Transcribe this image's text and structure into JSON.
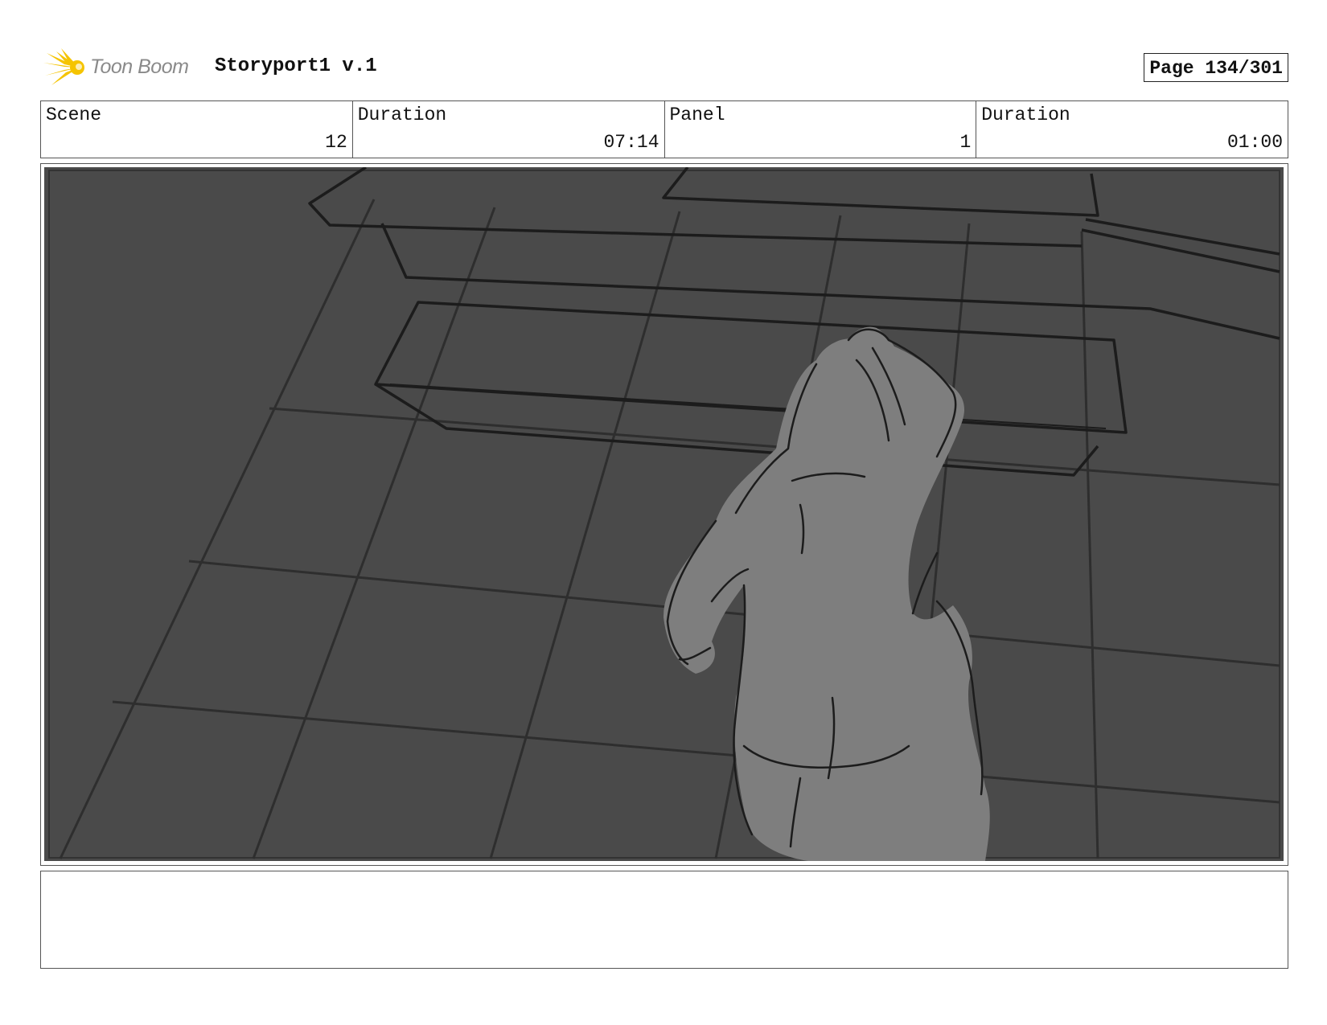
{
  "header": {
    "logo_text": "Toon Boom",
    "logo_icon": "starburst-logo-icon",
    "project_title": "Storyport1 v.1",
    "page_label": "Page 134/301"
  },
  "info": {
    "scene_label": "Scene",
    "scene_value": "12",
    "scene_duration_label": "Duration",
    "scene_duration_value": "07:14",
    "panel_label": "Panel",
    "panel_value": "1",
    "panel_duration_label": "Duration",
    "panel_duration_value": "01:00"
  },
  "panel": {
    "background_color": "#4a4a4a",
    "figure_color": "#7e7e7e",
    "line_color": "#1c1c1c",
    "logo_color": "#f5c400"
  },
  "notes": {
    "text": ""
  }
}
